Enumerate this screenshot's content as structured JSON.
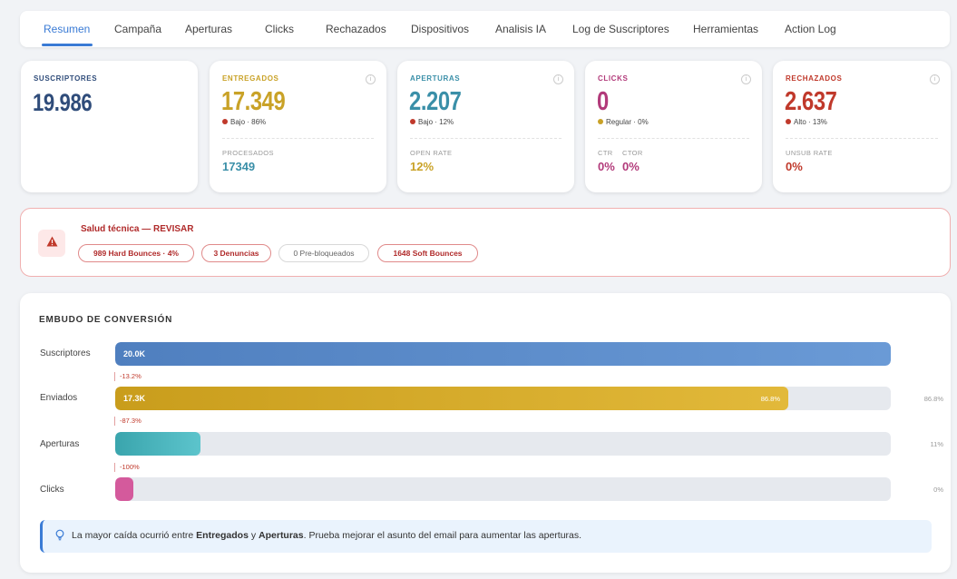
{
  "tabs": [
    "Resumen",
    "Campaña",
    "Aperturas",
    "Clicks",
    "Rechazados",
    "Dispositivos",
    "Analisis IA",
    "Log de Suscriptores",
    "Herramientas",
    "Action Log"
  ],
  "active_tab": "Resumen",
  "cards": {
    "suscriptores": {
      "title": "SUSCRIPTORES",
      "value": "19.986"
    },
    "entregados": {
      "title": "ENTREGADOS",
      "value": "17.349",
      "status": "Bajo · 86%",
      "sub_label": "PROCESADOS",
      "sub_value": "17349"
    },
    "aperturas": {
      "title": "APERTURAS",
      "value": "2.207",
      "status": "Bajo · 12%",
      "sub_label": "OPEN RATE",
      "sub_value": "12%"
    },
    "clicks": {
      "title": "CLICKS",
      "value": "0",
      "status": "Regular · 0%",
      "sub_label_1": "CTR",
      "sub_value_1": "0%",
      "sub_label_2": "CTOR",
      "sub_value_2": "0%"
    },
    "rechazados": {
      "title": "RECHAZADOS",
      "value": "2.637",
      "status": "Alto · 13%",
      "sub_label": "UNSUB RATE",
      "sub_value": "0%"
    }
  },
  "info_glyph": "i",
  "health": {
    "title": "Salud técnica — REVISAR",
    "icon": "warning-triangle",
    "pills": [
      "989 Hard Bounces · 4%",
      "3 Denuncias",
      "0 Pre-bloqueados",
      "1648 Soft Bounces"
    ]
  },
  "funnel": {
    "title": "EMBUDO DE CONVERSIÓN",
    "rows": [
      {
        "label": "Suscriptores",
        "value": "20.0K",
        "fraction": 1.0,
        "bar_pct": "",
        "right_pct": ""
      },
      {
        "label": "Enviados",
        "value": "17.3K",
        "fraction": 0.868,
        "bar_pct": "86.8%",
        "right_pct": "86.8%"
      },
      {
        "label": "Aperturas",
        "value": "",
        "fraction": 0.11,
        "bar_pct": "",
        "right_pct": "11%"
      },
      {
        "label": "Clicks",
        "value": "",
        "fraction": 0.0,
        "bar_pct": "",
        "right_pct": "0%"
      }
    ],
    "drops": [
      "-13.2%",
      "-87.3%",
      "-100%"
    ],
    "insight": {
      "icon": "lightbulb",
      "prefix": "La mayor caída ocurrió entre ",
      "from": "Entregados",
      "mid": " y ",
      "to": "Aperturas",
      "suffix": ". Prueba mejorar el asunto del email para aumentar las aperturas."
    }
  },
  "colors": {
    "accent": "#3a7bd5",
    "suscriptores": "#2f4c7a",
    "entregados": "#c9a227",
    "aperturas": "#3aa7b0",
    "clicks": "#b23a7a",
    "rechazados": "#c0392b",
    "bar_suscriptores": "#5b8cc9",
    "bar_enviados": "#d4aa25",
    "bar_aperturas": "#48b8c0",
    "bar_clicks": "#d45a9c"
  }
}
